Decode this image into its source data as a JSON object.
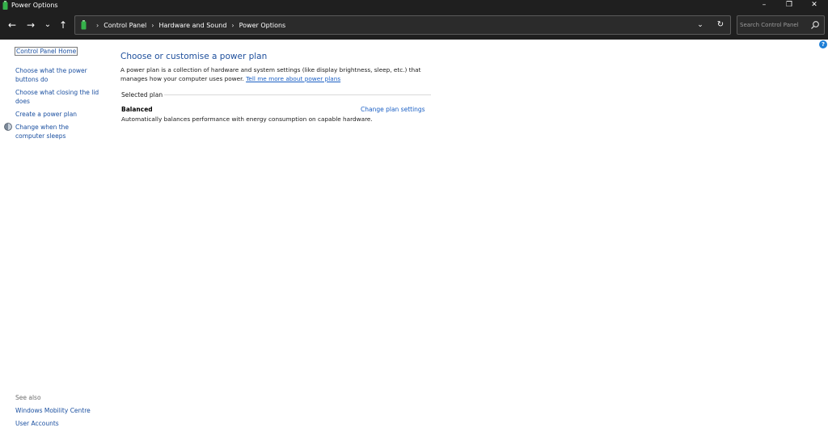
{
  "window": {
    "title": "Power Options",
    "controls": {
      "minimize": "–",
      "restore": "❐",
      "close": "✕"
    }
  },
  "nav": {
    "back": "←",
    "forward": "→",
    "recent": "⌄",
    "up": "↑"
  },
  "breadcrumbs": [
    "Control Panel",
    "Hardware and Sound",
    "Power Options"
  ],
  "address": {
    "dropdown": "⌄",
    "refresh": "↻"
  },
  "search": {
    "placeholder": "Search Control Panel"
  },
  "help": {
    "glyph": "?"
  },
  "sidebar": {
    "home": "Control Panel Home",
    "links": [
      "Choose what the power buttons do",
      "Choose what closing the lid does",
      "Create a power plan",
      "Change when the computer sleeps"
    ],
    "see_also_label": "See also",
    "see_also": [
      "Windows Mobility Centre",
      "User Accounts"
    ]
  },
  "main": {
    "title": "Choose or customise a power plan",
    "description": "A power plan is a collection of hardware and system settings (like display brightness, sleep, etc.) that manages how your computer uses power.",
    "learn_more": "Tell me more about power plans",
    "section_label": "Selected plan",
    "plan": {
      "name": "Balanced",
      "change_link": "Change plan settings",
      "description": "Automatically balances performance with energy consumption on capable hardware."
    }
  },
  "icons": {
    "app": "battery-icon",
    "folder": "battery-icon",
    "search": "search-icon",
    "help": "help-icon",
    "shield": "shield-icon"
  },
  "colors": {
    "titlebar": "#1f1f1f",
    "link": "#1a4fa0",
    "heading": "#1e4f9c",
    "battery": "#35b24a"
  }
}
